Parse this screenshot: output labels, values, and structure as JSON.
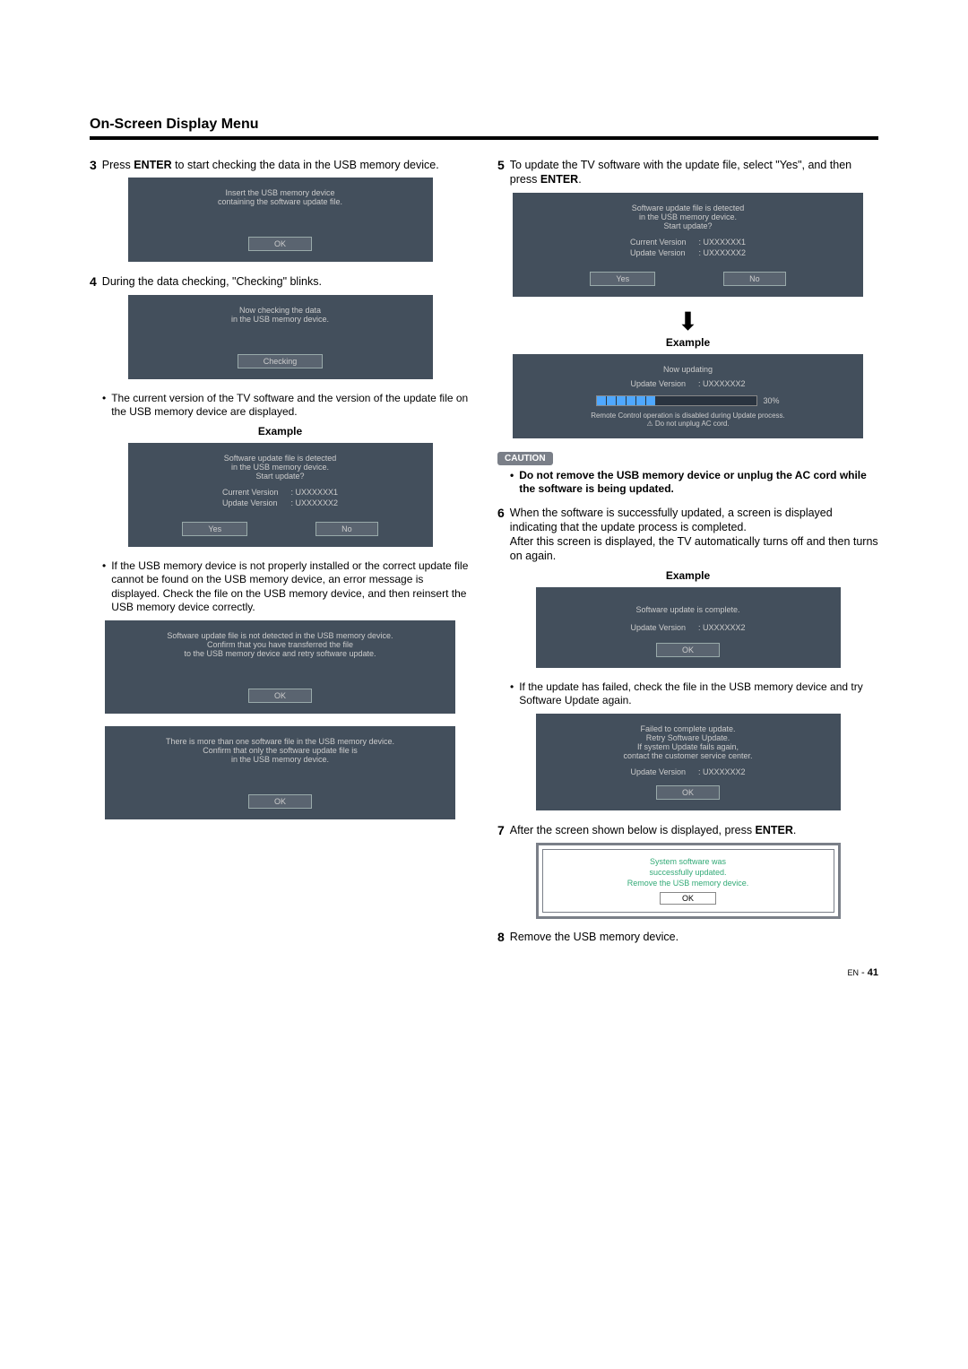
{
  "title": "On-Screen Display Menu",
  "left": {
    "step3_num": "3",
    "step3": "Press <b>ENTER</b> to start checking the data in the USB memory device.",
    "panel3_msg": "Insert the USB memory device<br>containing the software update file.",
    "ok": "OK",
    "step4_num": "4",
    "step4": "During the data checking, \"Checking\" blinks.",
    "panel4_msg": "Now checking the data<br>in the USB memory device.",
    "checking": "Checking",
    "bullet4": "The current version of the TV software and the version of the update file on the USB memory device are displayed.",
    "example": "Example",
    "panel5_msg": "Software update file is detected<br>in the USB memory device.<br>Start update?",
    "curr_label": "Current Version",
    "curr_val": ":  UXXXXXX1",
    "upd_label": "Update Version",
    "upd_val": ":  UXXXXXX2",
    "yes": "Yes",
    "no": "No",
    "bullet5": "If the USB memory device is not properly installed or the correct update file cannot be found on the USB memory device, an error message is displayed. Check the file on the USB memory device, and then reinsert the USB memory device correctly.",
    "err1": "Software update file is not detected in the USB memory device.<br>Confirm that you have transferred the file<br>to the USB memory device and retry software update.",
    "err2": "There is more than one software file in the USB memory device.<br>Confirm that only the software update file is<br>in the USB memory device."
  },
  "right": {
    "step5_num": "5",
    "step5": "To update the TV software with the update file, select \"Yes\", and then press <b>ENTER</b>.",
    "arrow": "",
    "example": "Example",
    "updating": "Now updating",
    "upd_label": "Update Version",
    "upd_val": ":  UXXXXXX2",
    "percent": "30%",
    "rc_note": "Remote Control operation is disabled during Update process.",
    "ac_note": "Do not unplug AC cord.",
    "caution_tag": "CAUTION",
    "caution": "Do not remove the USB memory device or unplug the AC cord while the software is being updated.",
    "step6_num": "6",
    "step6": "When the software is successfully updated, a screen is displayed indicating that the update process is completed.<br>After this screen is displayed, the TV automatically turns off and then turns on again.",
    "complete_msg": "Software update is complete.",
    "ok": "OK",
    "bullet6": "If the update has failed, check the file in the USB memory device and try Software Update again.",
    "fail_msg": "Failed to complete update.<br>Retry Software Update.<br>If system Update fails again,<br>contact the customer service center.",
    "step7_num": "7",
    "step7": "After the screen shown below is displayed, press <b>ENTER</b>.",
    "success_msg": "System software was<br>successfully updated.<br>Remove the USB memory device.",
    "step8_num": "8",
    "step8": "Remove the USB memory device."
  },
  "page": {
    "en": "EN",
    "sep": "-",
    "num": "41"
  }
}
